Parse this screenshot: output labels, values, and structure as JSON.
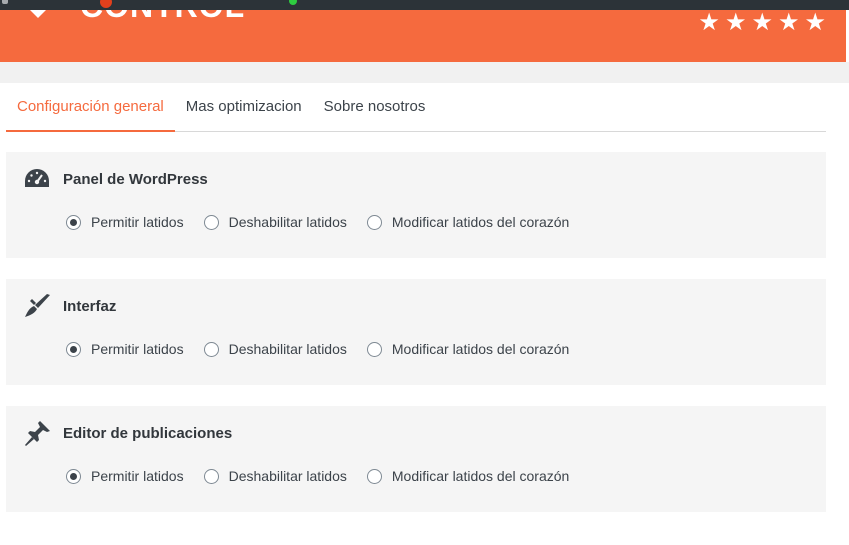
{
  "banner": {
    "title": "CONTROL",
    "rating_stars": 5,
    "star_icon": "★"
  },
  "tabs": [
    {
      "label": "Configuración general",
      "active": true
    },
    {
      "label": "Mas optimizacion",
      "active": false
    },
    {
      "label": "Sobre nosotros",
      "active": false
    }
  ],
  "sections": [
    {
      "title": "Panel de WordPress",
      "icon": "dashboard-icon",
      "options": [
        {
          "label": "Permitir latidos",
          "checked": true
        },
        {
          "label": "Deshabilitar latidos",
          "checked": false
        },
        {
          "label": "Modificar latidos del corazón",
          "checked": false
        }
      ]
    },
    {
      "title": "Interfaz",
      "icon": "brush-icon",
      "options": [
        {
          "label": "Permitir latidos",
          "checked": true
        },
        {
          "label": "Deshabilitar latidos",
          "checked": false
        },
        {
          "label": "Modificar latidos del corazón",
          "checked": false
        }
      ]
    },
    {
      "title": "Editor de publicaciones",
      "icon": "pin-icon",
      "options": [
        {
          "label": "Permitir latidos",
          "checked": true
        },
        {
          "label": "Deshabilitar latidos",
          "checked": false
        },
        {
          "label": "Modificar latidos del corazón",
          "checked": false
        }
      ]
    }
  ],
  "colors": {
    "accent": "#f56a3e",
    "card_bg": "#f5f5f5",
    "text": "#32373c"
  }
}
